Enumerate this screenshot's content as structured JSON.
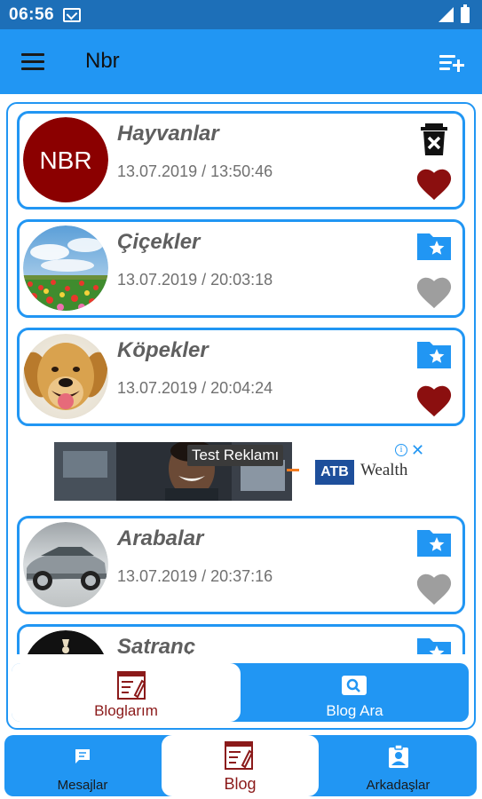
{
  "status_bar": {
    "time": "06:56"
  },
  "app_bar": {
    "title": "Nbr",
    "menu_icon": "menu-icon",
    "action_icon": "playlist-add-icon"
  },
  "blogs": [
    {
      "title": "Hayvanlar",
      "date": "13.07.2019 / 13:50:46",
      "avatar_text": "NBR",
      "action_icon": "delete-icon",
      "liked": true
    },
    {
      "title": "Çiçekler",
      "date": "13.07.2019 / 20:03:18",
      "action_icon": "folder-star-icon",
      "liked": false
    },
    {
      "title": "Köpekler",
      "date": "13.07.2019 / 20:04:24",
      "action_icon": "folder-star-icon",
      "liked": true
    },
    {
      "title": "Arabalar",
      "date": "13.07.2019 / 20:37:16",
      "action_icon": "folder-star-icon",
      "liked": false
    },
    {
      "title": "Satranç",
      "action_icon": "folder-star-icon"
    }
  ],
  "ad": {
    "label": "Test Reklamı",
    "logo": "ATB",
    "brand": "Wealth",
    "info": "i",
    "close": "✕"
  },
  "inner_tabs": [
    {
      "label": "Bloglarım",
      "icon": "blog-edit-icon",
      "active": true
    },
    {
      "label": "Blog Ara",
      "icon": "search-icon",
      "active": false
    }
  ],
  "bottom_nav": [
    {
      "label": "Mesajlar",
      "icon": "message-icon",
      "active": false
    },
    {
      "label": "Blog",
      "icon": "blog-edit-icon",
      "active": true
    },
    {
      "label": "Arkadaşlar",
      "icon": "contacts-icon",
      "active": false
    }
  ],
  "colors": {
    "primary": "#2196f3",
    "status_bar": "#1d6fb8",
    "heart_liked": "#8b0f0f",
    "heart_unliked": "#9e9e9e",
    "active_tab_text": "#8b1a1a"
  }
}
